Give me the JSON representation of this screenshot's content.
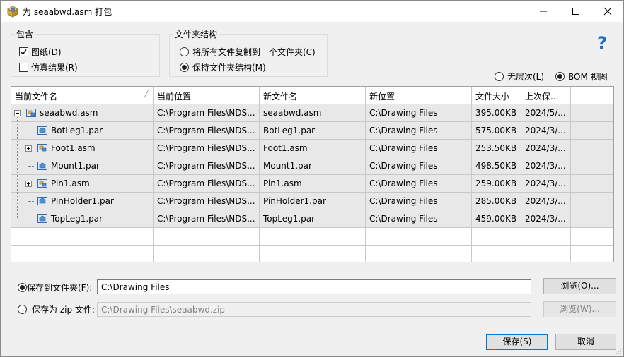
{
  "window": {
    "title": "为 seaabwd.asm 打包"
  },
  "include_group": {
    "label": "包含",
    "drawings": {
      "label": "图纸(D)",
      "checked": true
    },
    "simulation": {
      "label": "仿真结果(R)",
      "checked": false
    }
  },
  "folder_group": {
    "label": "文件夹结构",
    "copy_all": {
      "label": "将所有文件复制到一个文件夹(C)",
      "selected": false
    },
    "keep_structure": {
      "label": "保持文件夹结构(M)",
      "selected": true
    }
  },
  "view_options": {
    "flat": {
      "label": "无层次(L)",
      "selected": false
    },
    "bom": {
      "label": "BOM 视图",
      "selected": true
    }
  },
  "table": {
    "columns": [
      "当前文件名",
      "当前位置",
      "新文件名",
      "新位置",
      "文件大小",
      "上次保..."
    ],
    "rows": [
      {
        "name": "seaabwd.asm",
        "location": "C:\\Program Files\\NDS...",
        "new_name": "seaabwd.asm",
        "new_location": "C:\\Drawing Files",
        "size": "395.00KB",
        "saved": "2024/5/...",
        "type": "asm"
      },
      {
        "name": "BotLeg1.par",
        "location": "C:\\Program Files\\NDS...",
        "new_name": "BotLeg1.par",
        "new_location": "C:\\Drawing Files",
        "size": "575.00KB",
        "saved": "2024/3/...",
        "type": "par"
      },
      {
        "name": "Foot1.asm",
        "location": "C:\\Program Files\\NDS...",
        "new_name": "Foot1.asm",
        "new_location": "C:\\Drawing Files",
        "size": "253.50KB",
        "saved": "2024/3/...",
        "type": "asm"
      },
      {
        "name": "Mount1.par",
        "location": "C:\\Program Files\\NDS...",
        "new_name": "Mount1.par",
        "new_location": "C:\\Drawing Files",
        "size": "498.50KB",
        "saved": "2024/3/...",
        "type": "par"
      },
      {
        "name": "Pin1.asm",
        "location": "C:\\Program Files\\NDS...",
        "new_name": "Pin1.asm",
        "new_location": "C:\\Drawing Files",
        "size": "259.00KB",
        "saved": "2024/3/...",
        "type": "asm"
      },
      {
        "name": "PinHolder1.par",
        "location": "C:\\Program Files\\NDS...",
        "new_name": "PinHolder1.par",
        "new_location": "C:\\Drawing Files",
        "size": "285.00KB",
        "saved": "2024/3/...",
        "type": "par"
      },
      {
        "name": "TopLeg1.par",
        "location": "C:\\Program Files\\NDS...",
        "new_name": "TopLeg1.par",
        "new_location": "C:\\Drawing Files",
        "size": "459.00KB",
        "saved": "2024/3/...",
        "type": "par"
      }
    ]
  },
  "save_folder": {
    "label": "保存到文件夹(F):",
    "value": "C:\\Drawing Files",
    "selected": true,
    "browse": "浏览(O)..."
  },
  "save_zip": {
    "label": "保存为 zip 文件:",
    "value": "C:\\Drawing Files\\seaabwd.zip",
    "selected": false,
    "browse": "浏览(W)..."
  },
  "footer": {
    "save": "保存(S)",
    "cancel": "取消"
  },
  "colors": {
    "accent": "#0078d7",
    "row_fill": "#e8e8e8",
    "help": "#1e6fc2"
  },
  "icons": {
    "app": "package-icon",
    "assembly": "assembly-icon",
    "part": "part-icon",
    "help": "help-icon"
  }
}
